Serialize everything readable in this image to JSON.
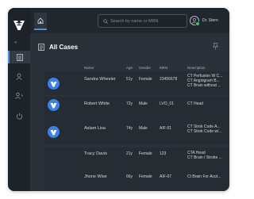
{
  "app": {
    "home_tab_label": "Home",
    "collapse_glyph": "«"
  },
  "search": {
    "placeholder": "Search by name or MRN",
    "value": ""
  },
  "user": {
    "name": "Dr. Stern"
  },
  "page": {
    "title": "All Cases"
  },
  "columns": {
    "name": "Name",
    "age": "Age",
    "gender": "Gender",
    "mrn": "MRN",
    "description": "Description"
  },
  "cases": [
    {
      "name": "Sandra Wheeler",
      "age": "51y",
      "gender": "Female",
      "mrn": "23456678",
      "desc": [
        "CT Perfusion W C...",
        "CT Angiogram B...",
        "CT Brain without ..."
      ],
      "has_badge": true
    },
    {
      "name": "Robert White",
      "age": "72y",
      "gender": "Male",
      "mrn": "LVO_01",
      "desc": [
        "CT Head"
      ],
      "has_badge": true
    },
    {
      "name": "Aslam Lisa",
      "age": "74y",
      "gender": "Male",
      "mrn": "AIF-01",
      "desc": [
        "CT Strok Code A...",
        "CT Strok Code w/..."
      ],
      "has_badge": true
    },
    {
      "name": "Tracy Davis",
      "age": "21y",
      "gender": "Female",
      "mrn": "123",
      "desc": [
        "CTA Head",
        "CT Brain / Stroke ..."
      ],
      "has_badge": false
    },
    {
      "name": "Jhone Wise",
      "age": "66y",
      "gender": "Female",
      "mrn": "AIF-07",
      "desc": [
        "Ct Brain For Acut..."
      ],
      "has_badge": false
    }
  ],
  "colors": {
    "accent": "#3c82e6",
    "status_online": "#3fbf6b",
    "background": "#2b3139"
  },
  "icons": {
    "logo": "brand-v-logo",
    "home": "home-icon",
    "search": "search-icon",
    "user": "user-icon",
    "caret": "chevron-down-icon",
    "cases": "cases-list-icon",
    "pin": "pin-icon",
    "team": "team-icon",
    "settings": "settings-icon",
    "power": "power-icon",
    "badge": "brand-v-badge"
  }
}
